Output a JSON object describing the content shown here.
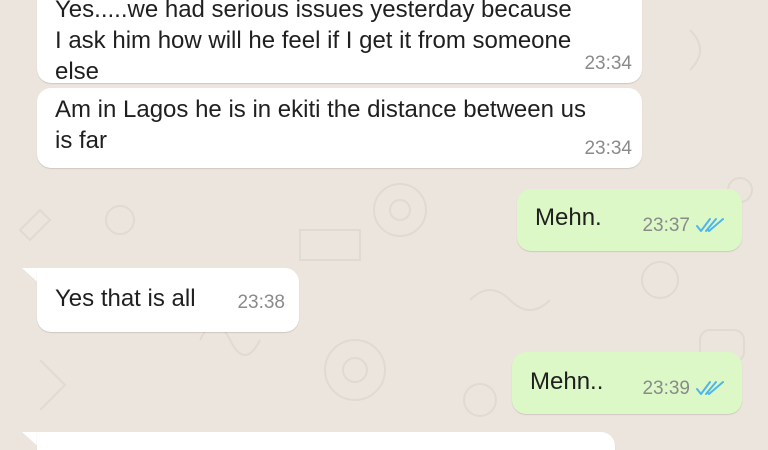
{
  "messages": [
    {
      "direction": "incoming",
      "text": "Yes.....we had serious issues yesterday because\nI ask him how will he feel if I get it from someone\nelse",
      "time": "23:34"
    },
    {
      "direction": "incoming",
      "text": "Am in Lagos he is in ekiti the distance between us\nis far",
      "time": "23:34"
    },
    {
      "direction": "outgoing",
      "text": "Mehn.",
      "time": "23:37",
      "status_icon": "double-check-read-icon"
    },
    {
      "direction": "incoming",
      "text": "Yes that is all",
      "time": "23:38"
    },
    {
      "direction": "outgoing",
      "text": "Mehn..",
      "time": "23:39",
      "status_icon": "double-check-read-icon"
    },
    {
      "direction": "incoming",
      "text": "",
      "time": ""
    }
  ],
  "colors": {
    "background": "#ece5dd",
    "incoming_bubble": "#ffffff",
    "outgoing_bubble": "#dcf8c6",
    "read_ticks": "#4fb6ec",
    "timestamp": "#8a8a8a"
  }
}
